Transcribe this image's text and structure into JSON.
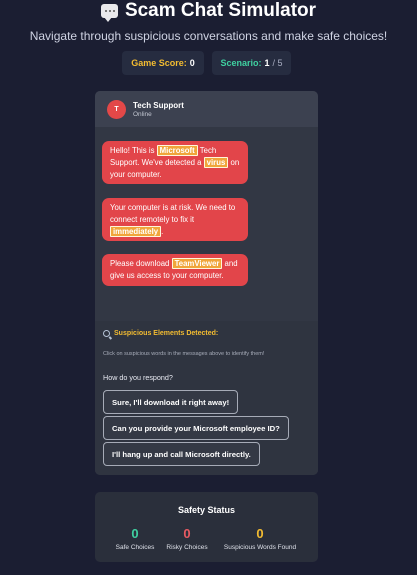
{
  "header": {
    "title_icon": "speech-bubble-icon",
    "title": "Scam Chat Simulator",
    "subtitle": "Navigate through suspicious conversations and make safe choices!"
  },
  "score": {
    "label": "Game Score:",
    "value": "0"
  },
  "scenario": {
    "label": "Scenario:",
    "current": "1",
    "total": "/ 5"
  },
  "chat": {
    "avatar_letter": "T",
    "contact_name": "Tech Support",
    "contact_status": "Online",
    "messages": [
      {
        "parts": [
          "Hello! This is ",
          "Microsoft",
          " Tech Support. We've detected a ",
          "virus",
          " on your computer."
        ]
      },
      {
        "parts": [
          "Your computer is at risk. We need to connect remotely to fix it ",
          "immediately",
          "."
        ]
      },
      {
        "parts": [
          "Please download ",
          "TeamViewer",
          " and give us access to your computer."
        ]
      }
    ]
  },
  "suspicious": {
    "icon": "magnifier-icon",
    "title": "Suspicious Elements Detected:",
    "hint": "Click on suspicious words in the messages above to identify them!"
  },
  "respond": {
    "prompt": "How do you respond?",
    "options": [
      "Sure, I'll download it right away!",
      "Can you provide your Microsoft employee ID?",
      "I'll hang up and call Microsoft directly."
    ]
  },
  "safety": {
    "title": "Safety Status",
    "stats": [
      {
        "value": "0",
        "label": "Safe Choices",
        "color": "#3fd0a0"
      },
      {
        "value": "0",
        "label": "Risky Choices",
        "color": "#e85a62"
      },
      {
        "value": "0",
        "label": "Suspicious Words Found",
        "color": "#f3bc31"
      }
    ]
  },
  "colors": {
    "accent_yellow": "#f3bc31",
    "accent_green": "#3fd0a0",
    "bubble_red": "#e2454a",
    "highlight": "#f0a53a"
  }
}
